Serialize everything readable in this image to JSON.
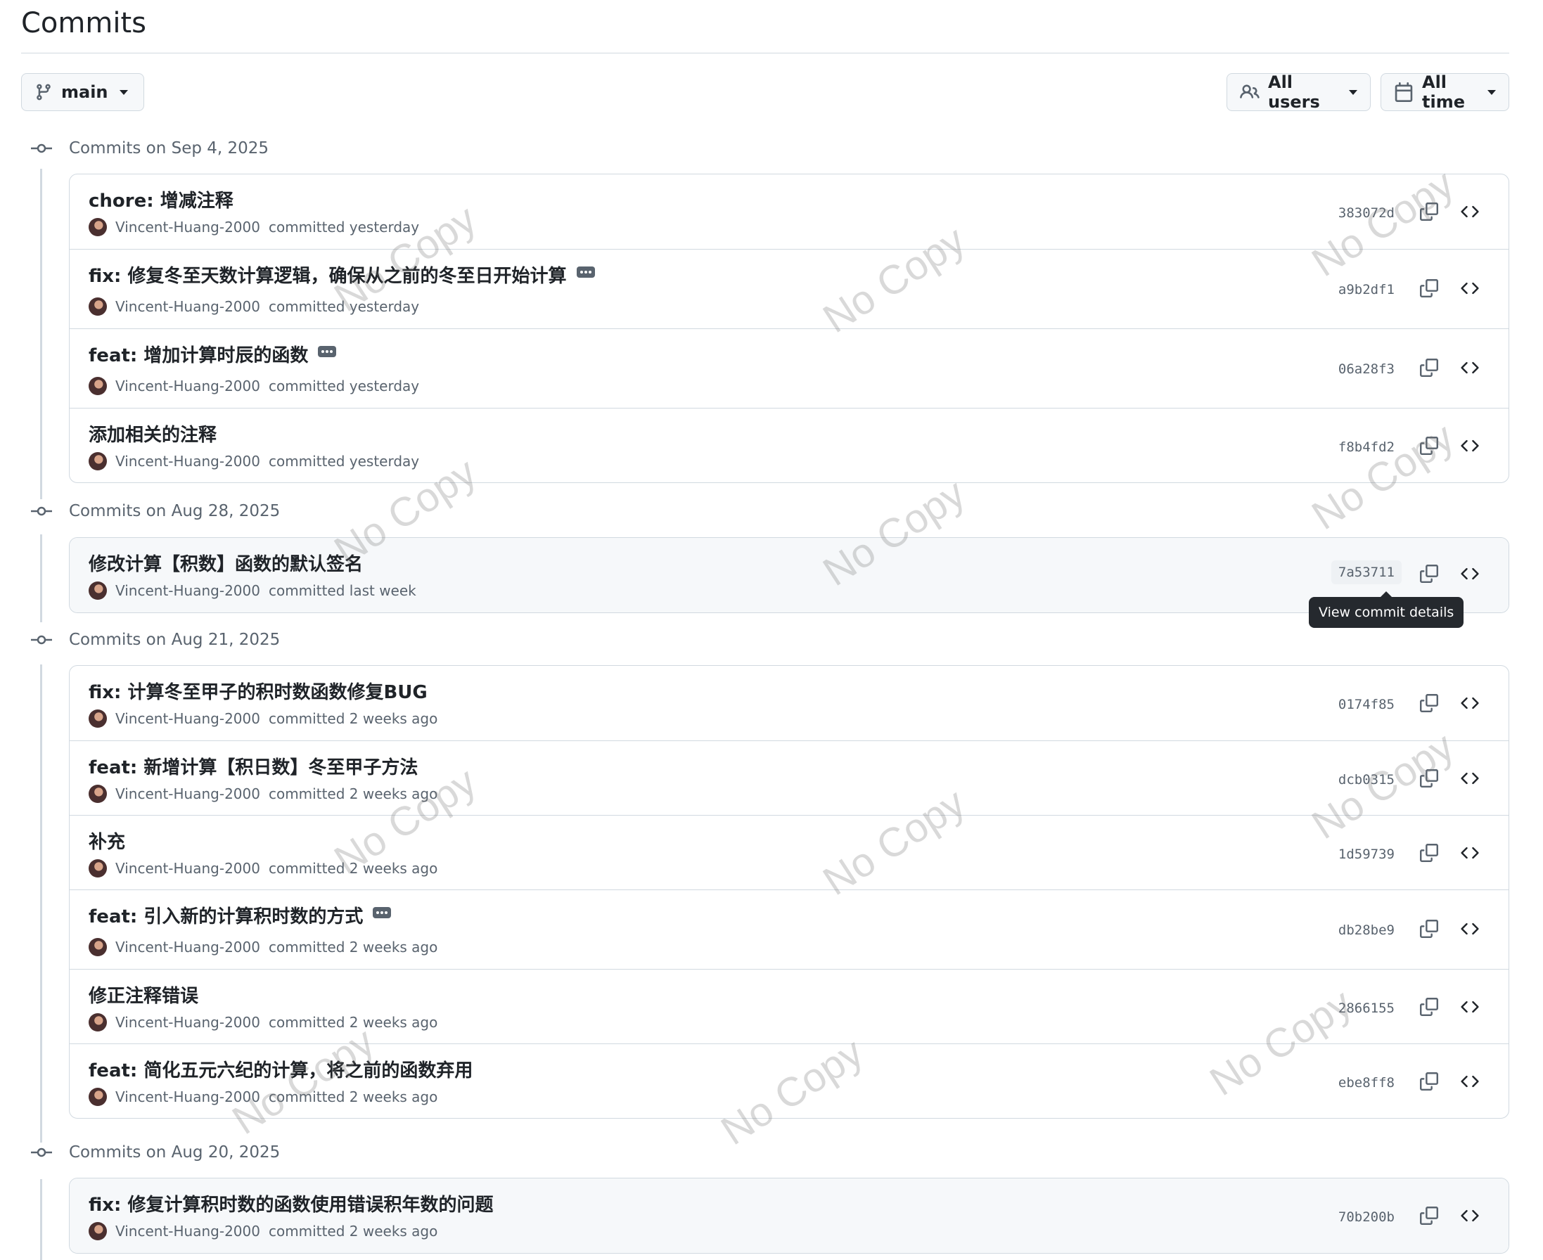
{
  "page": {
    "title": "Commits"
  },
  "filters": {
    "branch": "main",
    "users": "All users",
    "time": "All time"
  },
  "icons": {
    "branch": "git-branch-icon",
    "users": "people-icon",
    "time": "calendar-icon",
    "commit": "git-commit-icon",
    "copy": "copy-icon",
    "browse": "code-icon",
    "more": "ellipsis-icon"
  },
  "groups": [
    {
      "heading": "Commits on Sep 4, 2025",
      "commits": [
        {
          "message": "chore: 增减注释",
          "author": "Vincent-Huang-2000",
          "action": "committed yesterday",
          "sha": "383072d",
          "more": false
        },
        {
          "message": "fix: 修复冬至天数计算逻辑，确保从之前的冬至日开始计算",
          "author": "Vincent-Huang-2000",
          "action": "committed yesterday",
          "sha": "a9b2df1",
          "more": true
        },
        {
          "message": "feat: 增加计算时辰的函数",
          "author": "Vincent-Huang-2000",
          "action": "committed yesterday",
          "sha": "06a28f3",
          "more": true
        },
        {
          "message": "添加相关的注释",
          "author": "Vincent-Huang-2000",
          "action": "committed yesterday",
          "sha": "f8b4fd2",
          "more": false
        }
      ]
    },
    {
      "heading": "Commits on Aug 28, 2025",
      "commits": [
        {
          "message": "修改计算【积数】函数的默认签名",
          "author": "Vincent-Huang-2000",
          "action": "committed last week",
          "sha": "7a53711",
          "more": false
        }
      ]
    },
    {
      "heading": "Commits on Aug 21, 2025",
      "commits": [
        {
          "message": "fix: 计算冬至甲子的积时数函数修复BUG",
          "author": "Vincent-Huang-2000",
          "action": "committed 2 weeks ago",
          "sha": "0174f85",
          "more": false
        },
        {
          "message": "feat: 新增计算【积日数】冬至甲子方法",
          "author": "Vincent-Huang-2000",
          "action": "committed 2 weeks ago",
          "sha": "dcb0315",
          "more": false
        },
        {
          "message": "补充",
          "author": "Vincent-Huang-2000",
          "action": "committed 2 weeks ago",
          "sha": "1d59739",
          "more": false
        },
        {
          "message": "feat: 引入新的计算积时数的方式",
          "author": "Vincent-Huang-2000",
          "action": "committed 2 weeks ago",
          "sha": "db28be9",
          "more": true
        },
        {
          "message": "修正注释错误",
          "author": "Vincent-Huang-2000",
          "action": "committed 2 weeks ago",
          "sha": "2866155",
          "more": false
        },
        {
          "message": "feat: 简化五元六纪的计算，将之前的函数弃用",
          "author": "Vincent-Huang-2000",
          "action": "committed 2 weeks ago",
          "sha": "ebe8ff8",
          "more": false
        }
      ]
    },
    {
      "heading": "Commits on Aug 20, 2025",
      "commits": [
        {
          "message": "fix: 修复计算积时数的函数使用错误积年数的问题",
          "author": "Vincent-Huang-2000",
          "action": "committed 2 weeks ago",
          "sha": "70b200b",
          "more": false
        }
      ]
    }
  ],
  "tooltip": "View commit details",
  "watermark": "No Copy"
}
